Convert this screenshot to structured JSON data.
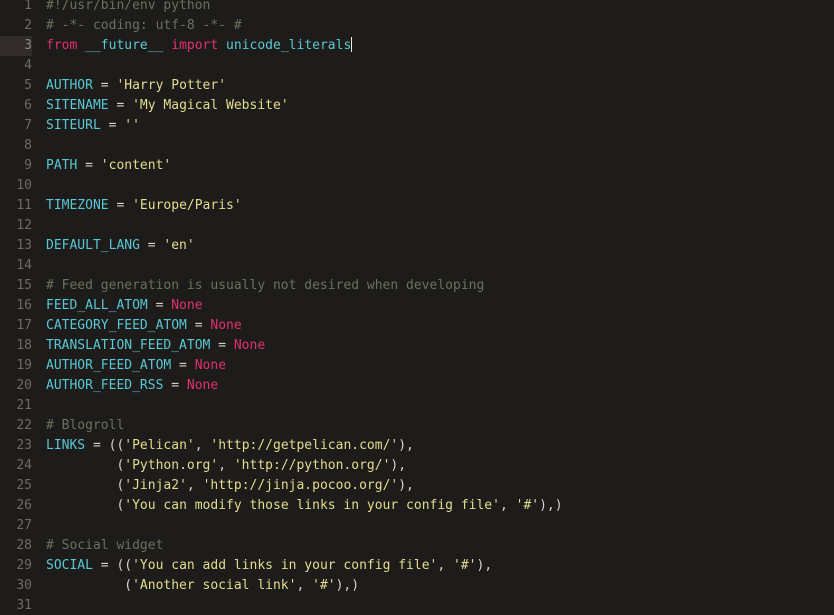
{
  "editor": {
    "name": "code-editor",
    "language": "Python",
    "theme": {
      "background": "#1e1b1b",
      "foreground": "#d6d3ce",
      "gutter_text": "#6e6a68",
      "active_line_gutter_bg": "#312c2b",
      "comment": "#6c705c",
      "keyword": "#e1326b",
      "name": "#57c8d4",
      "string": "#e2dd8e",
      "constant_none": "#e1326b",
      "caret": "#e8e6e2"
    },
    "cursor": {
      "line": 3,
      "column": 44
    },
    "active_line": 3,
    "total_visible_lines": 31
  },
  "lines": [
    {
      "num": "1",
      "tokens": [
        {
          "t": "com",
          "v": "#!/usr/bin/env python"
        }
      ]
    },
    {
      "num": "2",
      "tokens": [
        {
          "t": "com",
          "v": "# -*- coding: utf-8 -*- #"
        }
      ]
    },
    {
      "num": "3",
      "tokens": [
        {
          "t": "kw",
          "v": "from"
        },
        {
          "t": "pl",
          "v": " "
        },
        {
          "t": "name",
          "v": "__future__"
        },
        {
          "t": "pl",
          "v": " "
        },
        {
          "t": "kw",
          "v": "import"
        },
        {
          "t": "pl",
          "v": " "
        },
        {
          "t": "name",
          "v": "unicode_literals"
        },
        {
          "t": "caret",
          "v": ""
        }
      ]
    },
    {
      "num": "4",
      "tokens": []
    },
    {
      "num": "5",
      "tokens": [
        {
          "t": "var",
          "v": "AUTHOR"
        },
        {
          "t": "op",
          "v": " = "
        },
        {
          "t": "str",
          "v": "'Harry Potter'"
        }
      ]
    },
    {
      "num": "6",
      "tokens": [
        {
          "t": "var",
          "v": "SITENAME"
        },
        {
          "t": "op",
          "v": " = "
        },
        {
          "t": "str",
          "v": "'My Magical Website'"
        }
      ]
    },
    {
      "num": "7",
      "tokens": [
        {
          "t": "var",
          "v": "SITEURL"
        },
        {
          "t": "op",
          "v": " = "
        },
        {
          "t": "str",
          "v": "''"
        }
      ]
    },
    {
      "num": "8",
      "tokens": []
    },
    {
      "num": "9",
      "tokens": [
        {
          "t": "var",
          "v": "PATH"
        },
        {
          "t": "op",
          "v": " = "
        },
        {
          "t": "str",
          "v": "'content'"
        }
      ]
    },
    {
      "num": "10",
      "tokens": []
    },
    {
      "num": "11",
      "tokens": [
        {
          "t": "var",
          "v": "TIMEZONE"
        },
        {
          "t": "op",
          "v": " = "
        },
        {
          "t": "str",
          "v": "'Europe/Paris'"
        }
      ]
    },
    {
      "num": "12",
      "tokens": []
    },
    {
      "num": "13",
      "tokens": [
        {
          "t": "var",
          "v": "DEFAULT_LANG"
        },
        {
          "t": "op",
          "v": " = "
        },
        {
          "t": "str",
          "v": "'en'"
        }
      ]
    },
    {
      "num": "14",
      "tokens": []
    },
    {
      "num": "15",
      "tokens": [
        {
          "t": "com",
          "v": "# Feed generation is usually not desired when developing"
        }
      ]
    },
    {
      "num": "16",
      "tokens": [
        {
          "t": "var",
          "v": "FEED_ALL_ATOM"
        },
        {
          "t": "op",
          "v": " = "
        },
        {
          "t": "none",
          "v": "None"
        }
      ]
    },
    {
      "num": "17",
      "tokens": [
        {
          "t": "var",
          "v": "CATEGORY_FEED_ATOM"
        },
        {
          "t": "op",
          "v": " = "
        },
        {
          "t": "none",
          "v": "None"
        }
      ]
    },
    {
      "num": "18",
      "tokens": [
        {
          "t": "var",
          "v": "TRANSLATION_FEED_ATOM"
        },
        {
          "t": "op",
          "v": " = "
        },
        {
          "t": "none",
          "v": "None"
        }
      ]
    },
    {
      "num": "19",
      "tokens": [
        {
          "t": "var",
          "v": "AUTHOR_FEED_ATOM"
        },
        {
          "t": "op",
          "v": " = "
        },
        {
          "t": "none",
          "v": "None"
        }
      ]
    },
    {
      "num": "20",
      "tokens": [
        {
          "t": "var",
          "v": "AUTHOR_FEED_RSS"
        },
        {
          "t": "op",
          "v": " = "
        },
        {
          "t": "none",
          "v": "None"
        }
      ]
    },
    {
      "num": "21",
      "tokens": []
    },
    {
      "num": "22",
      "tokens": [
        {
          "t": "com",
          "v": "# Blogroll"
        }
      ]
    },
    {
      "num": "23",
      "tokens": [
        {
          "t": "var",
          "v": "LINKS"
        },
        {
          "t": "op",
          "v": " = "
        },
        {
          "t": "pl",
          "v": "(("
        },
        {
          "t": "str",
          "v": "'Pelican'"
        },
        {
          "t": "pl",
          "v": ", "
        },
        {
          "t": "str",
          "v": "'http://getpelican.com/'"
        },
        {
          "t": "pl",
          "v": "),"
        }
      ]
    },
    {
      "num": "24",
      "tokens": [
        {
          "t": "pl",
          "v": "         ("
        },
        {
          "t": "str",
          "v": "'Python.org'"
        },
        {
          "t": "pl",
          "v": ", "
        },
        {
          "t": "str",
          "v": "'http://python.org/'"
        },
        {
          "t": "pl",
          "v": "),"
        }
      ]
    },
    {
      "num": "25",
      "tokens": [
        {
          "t": "pl",
          "v": "         ("
        },
        {
          "t": "str",
          "v": "'Jinja2'"
        },
        {
          "t": "pl",
          "v": ", "
        },
        {
          "t": "str",
          "v": "'http://jinja.pocoo.org/'"
        },
        {
          "t": "pl",
          "v": "),"
        }
      ]
    },
    {
      "num": "26",
      "tokens": [
        {
          "t": "pl",
          "v": "         ("
        },
        {
          "t": "str",
          "v": "'You can modify those links in your config file'"
        },
        {
          "t": "pl",
          "v": ", "
        },
        {
          "t": "str",
          "v": "'#'"
        },
        {
          "t": "pl",
          "v": "),)"
        }
      ]
    },
    {
      "num": "27",
      "tokens": []
    },
    {
      "num": "28",
      "tokens": [
        {
          "t": "com",
          "v": "# Social widget"
        }
      ]
    },
    {
      "num": "29",
      "tokens": [
        {
          "t": "var",
          "v": "SOCIAL"
        },
        {
          "t": "op",
          "v": " = "
        },
        {
          "t": "pl",
          "v": "(("
        },
        {
          "t": "str",
          "v": "'You can add links in your config file'"
        },
        {
          "t": "pl",
          "v": ", "
        },
        {
          "t": "str",
          "v": "'#'"
        },
        {
          "t": "pl",
          "v": "),"
        }
      ]
    },
    {
      "num": "30",
      "tokens": [
        {
          "t": "pl",
          "v": "          ("
        },
        {
          "t": "str",
          "v": "'Another social link'"
        },
        {
          "t": "pl",
          "v": ", "
        },
        {
          "t": "str",
          "v": "'#'"
        },
        {
          "t": "pl",
          "v": "),)"
        }
      ]
    },
    {
      "num": "31",
      "tokens": []
    }
  ]
}
